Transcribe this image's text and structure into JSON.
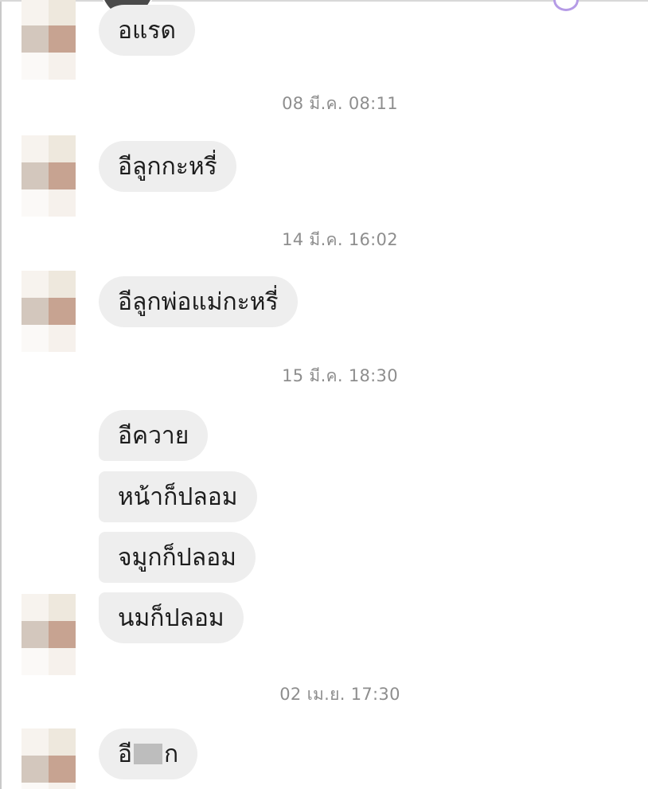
{
  "chat": {
    "timestamps": [
      "08 มี.ค. 08:11",
      "14 มี.ค. 16:02",
      "15 มี.ค. 18:30",
      "02 เม.ย. 17:30"
    ],
    "messages": {
      "m0": "อแรด",
      "m1": "อีลูกกะหรี่",
      "m2": "อีลูกพ่อแม่กะหรี่",
      "m3": "อีควาย",
      "m4": "หน้าก็ปลอม",
      "m5": "จมูกก็ปลอม",
      "m6": "นมก็ปลอม",
      "m7_prefix": "อี",
      "m7_suffix": "ก"
    }
  },
  "colors": {
    "bubble_bg": "#eeeeee",
    "timestamp_text": "#8e8e8e",
    "message_text": "#1c1c1c",
    "story_ring": "#b59be6"
  },
  "icons": {
    "avatar": "pixelated-avatar",
    "censor": "censor-block"
  }
}
